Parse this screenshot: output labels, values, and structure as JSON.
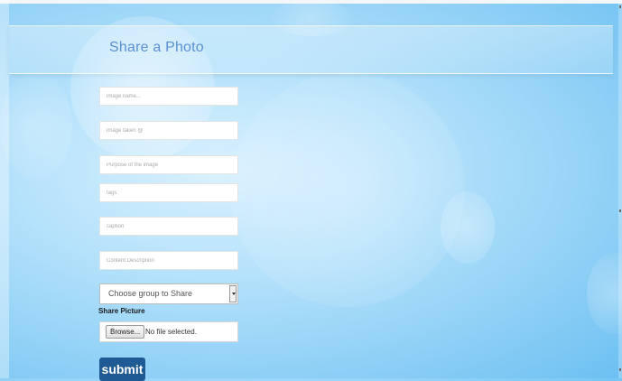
{
  "header": {
    "title": "Share a Photo"
  },
  "form": {
    "fields": [
      {
        "placeholder": "image name..."
      },
      {
        "placeholder": "image taken @"
      },
      {
        "placeholder": "Purpose of the image"
      },
      {
        "placeholder": "tags"
      },
      {
        "placeholder": "caption"
      },
      {
        "placeholder": "Content Description"
      }
    ],
    "group_select": {
      "value": "Choose group to Share"
    },
    "share_picture": {
      "label": "Share Picture",
      "browse_label": "Browse...",
      "status": "No file selected."
    },
    "submit_label": "submit"
  },
  "colors": {
    "title": "#5b90d6",
    "submit_bg": "#1f5a94",
    "background": "#9fd6f7"
  },
  "icons": [
    "dropdown-arrow-icon"
  ]
}
